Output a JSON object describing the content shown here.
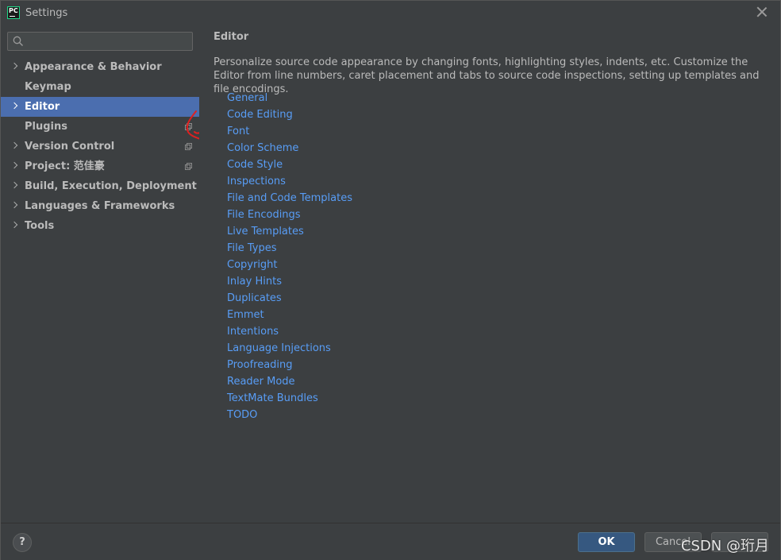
{
  "window": {
    "title": "Settings",
    "app_icon_text": "PC"
  },
  "sidebar": {
    "search_placeholder": "",
    "items": [
      {
        "label": "Appearance & Behavior",
        "expandable": true
      },
      {
        "label": "Keymap",
        "expandable": false
      },
      {
        "label": "Editor",
        "expandable": true,
        "selected": true
      },
      {
        "label": "Plugins",
        "expandable": false,
        "project_icon": true
      },
      {
        "label": "Version Control",
        "expandable": true,
        "project_icon": true
      },
      {
        "label": "Project: 范佳豪",
        "expandable": true,
        "project_icon": true
      },
      {
        "label": "Build, Execution, Deployment",
        "expandable": true
      },
      {
        "label": "Languages & Frameworks",
        "expandable": true
      },
      {
        "label": "Tools",
        "expandable": true
      }
    ]
  },
  "content": {
    "heading": "Editor",
    "description": "Personalize source code appearance by changing fonts, highlighting styles, indents, etc. Customize the Editor from line numbers, caret placement and tabs to source code inspections, setting up templates and file encodings.",
    "links": [
      "General",
      "Code Editing",
      "Font",
      "Color Scheme",
      "Code Style",
      "Inspections",
      "File and Code Templates",
      "File Encodings",
      "Live Templates",
      "File Types",
      "Copyright",
      "Inlay Hints",
      "Duplicates",
      "Emmet",
      "Intentions",
      "Language Injections",
      "Proofreading",
      "Reader Mode",
      "TextMate Bundles",
      "TODO"
    ]
  },
  "footer": {
    "help_label": "?",
    "ok_label": "OK",
    "cancel_label": "Cancel",
    "apply_label": ""
  },
  "watermark": "CSDN @珩月",
  "colors": {
    "background": "#3c3f41",
    "selection": "#4b6eaf",
    "link": "#589df6",
    "ok_button": "#365880",
    "annotation": "#e02020"
  }
}
